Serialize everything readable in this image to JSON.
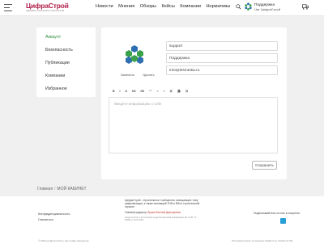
{
  "header": {
    "logo_main": "ЦифраСтрой",
    "logo_sub": "цифровые технологии в строительстве",
    "nav": [
      "Новости",
      "Мнения",
      "Обзоры",
      "Кейсы",
      "Компании",
      "Нормативы"
    ],
    "support_title": "Поддержка",
    "support_sub": "Чат ЦифраСтрой"
  },
  "sidebar": {
    "items": [
      {
        "label": "Аккаунт",
        "active": true
      },
      {
        "label": "Безопасность",
        "active": false
      },
      {
        "label": "Публикации",
        "active": false
      },
      {
        "label": "Компании",
        "active": false
      },
      {
        "label": "Избранное",
        "active": false
      }
    ]
  },
  "profile": {
    "change_label": "Заменить",
    "delete_label": "Удалить",
    "field1_value": "support",
    "field2_value": "Поддержка",
    "field3_value": "info@lesmedia.ru",
    "toolbar": [
      "B",
      "I",
      "U",
      "H2",
      "H3",
      "“”",
      "≡",
      "≡",
      "☰",
      "⛓",
      "⊡"
    ],
    "editor_placeholder": "Введите информацию о себе",
    "save_label": "Сохранить"
  },
  "breadcrumb": {
    "home": "Главная",
    "current": "МОЙ КАБИНЕТ"
  },
  "footer": {
    "privacy": "Конфиденциальность",
    "contacts": "Связаться",
    "copyright": "© 2024 цифрастрой.ру, все права защищены",
    "about": "ЦифраСтрой - строительное Сообщество освещающее тему цифровизации, а также инноваций ТИМ и BIM в строительной отрасли",
    "editor_line_prefix": "Главный редактор",
    "editor_name": "Ярцев Евгений Дмитриевич",
    "small_text": "свидетельство о регистрации средства массовой информации ЭЛ № ФС 77 - 81455 от 16.07.2021",
    "subscribe": "Подписывайтесь на нас в соцсетях",
    "credits": "Пользовательское соглашение Правила по обработке ПД"
  },
  "colors": {
    "accent_green": "#2d8d3c",
    "logo_red": "#b01c4a",
    "telegram": "#2a9fd6"
  }
}
